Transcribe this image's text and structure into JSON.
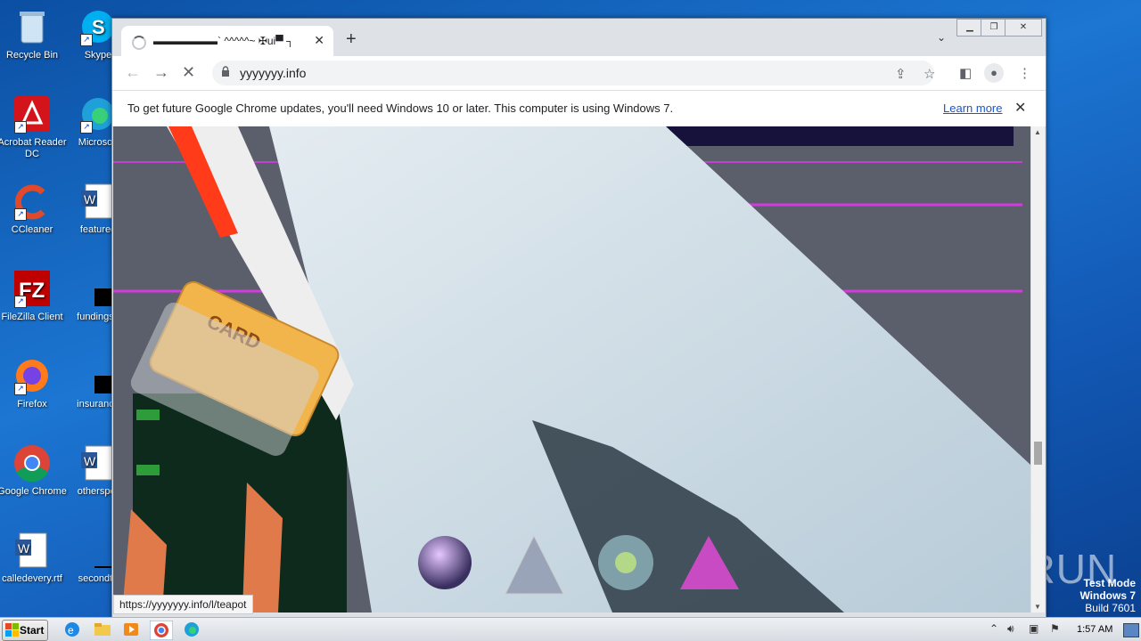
{
  "desktop": {
    "icons": [
      {
        "label": "Recycle Bin"
      },
      {
        "label": "Skype"
      },
      {
        "label": "Acrobat Reader DC"
      },
      {
        "label": "Microsoft"
      },
      {
        "label": "CCleaner"
      },
      {
        "label": "featured"
      },
      {
        "label": "FileZilla Client"
      },
      {
        "label": "fundingse"
      },
      {
        "label": "Firefox"
      },
      {
        "label": "insurance"
      },
      {
        "label": "Google Chrome"
      },
      {
        "label": "otherspor"
      },
      {
        "label": "calledevery.rtf"
      },
      {
        "label": "secondto"
      }
    ],
    "watermark": "ANY RUN",
    "test_mode": {
      "line1": "Test Mode",
      "line2": "Windows 7",
      "line3": "Build 7601"
    }
  },
  "browser": {
    "tab_title": "▬▬▬▬▬▬` ^^^^^~ ✠ui▀ ┐",
    "address": "yyyyyyy.info",
    "infobar_message": "To get future Google Chrome updates, you'll need Windows 10 or later. This computer is using Windows 7.",
    "infobar_link": "Learn more",
    "status_url": "https://yyyyyyy.info/l/teapot"
  },
  "taskbar": {
    "start_label": "Start",
    "clock": "1:57 AM"
  },
  "colors": {
    "desktop_blue": "#1c76d2",
    "chrome_frame": "#dee1e6",
    "link_blue": "#1a57c7"
  }
}
